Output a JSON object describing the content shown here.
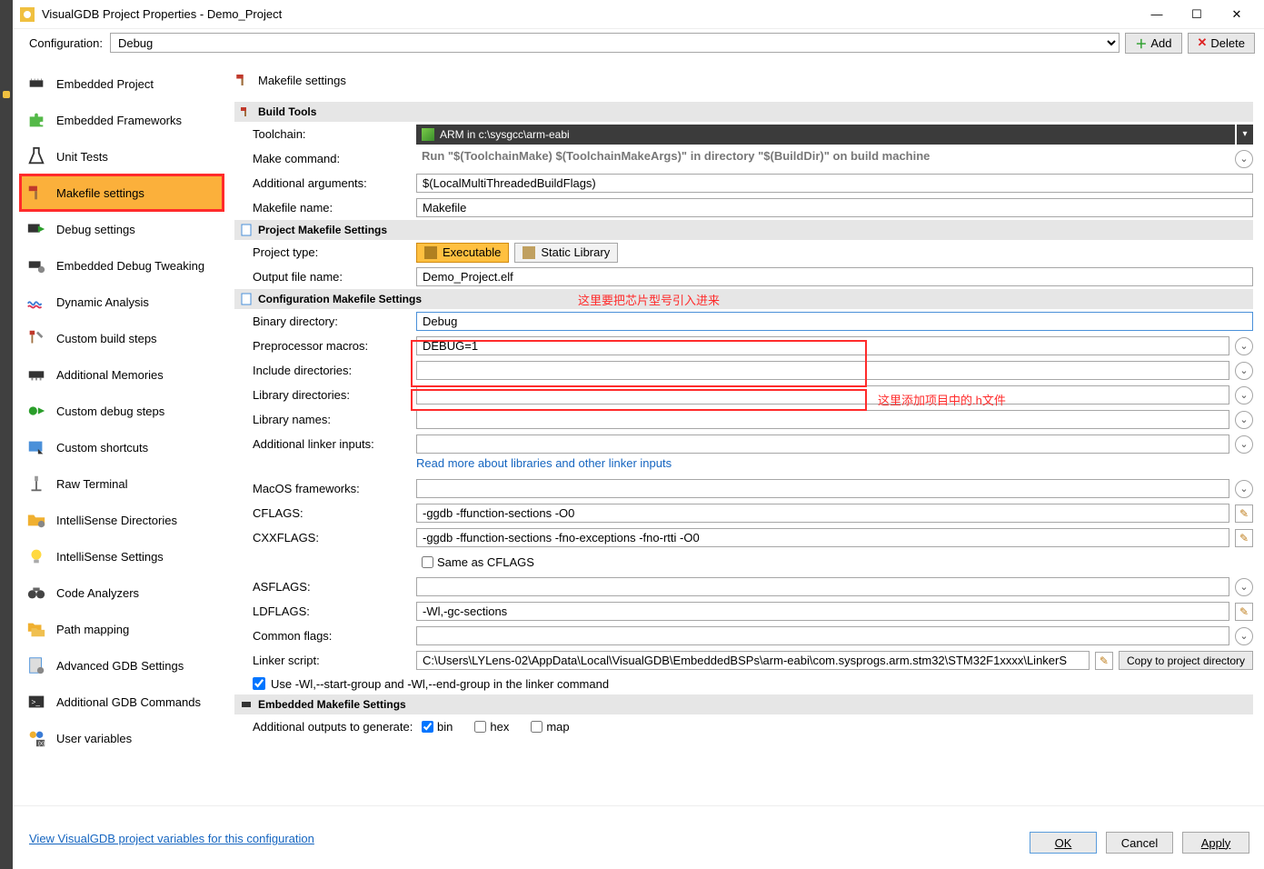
{
  "window": {
    "title": "VisualGDB Project Properties - Demo_Project"
  },
  "config": {
    "label": "Configuration:",
    "value": "Debug",
    "add": "Add",
    "delete": "Delete"
  },
  "sidebar": {
    "items": [
      {
        "label": "Embedded Project"
      },
      {
        "label": "Embedded Frameworks"
      },
      {
        "label": "Unit Tests"
      },
      {
        "label": "Makefile settings"
      },
      {
        "label": "Debug settings"
      },
      {
        "label": "Embedded Debug Tweaking"
      },
      {
        "label": "Dynamic Analysis"
      },
      {
        "label": "Custom build steps"
      },
      {
        "label": "Additional Memories"
      },
      {
        "label": "Custom debug steps"
      },
      {
        "label": "Custom shortcuts"
      },
      {
        "label": "Raw Terminal"
      },
      {
        "label": "IntelliSense Directories"
      },
      {
        "label": "IntelliSense Settings"
      },
      {
        "label": "Code Analyzers"
      },
      {
        "label": "Path mapping"
      },
      {
        "label": "Advanced GDB Settings"
      },
      {
        "label": "Additional GDB Commands"
      },
      {
        "label": "User variables"
      }
    ]
  },
  "content": {
    "title": "Makefile settings",
    "sections": {
      "build_tools": {
        "header": "Build Tools",
        "toolchain_label": "Toolchain:",
        "toolchain_value": "ARM in c:\\sysgcc\\arm-eabi",
        "make_cmd_label": "Make command:",
        "make_cmd_value": "Run \"$(ToolchainMake) $(ToolchainMakeArgs)\" in directory \"$(BuildDir)\" on build machine",
        "addl_args_label": "Additional arguments:",
        "addl_args_value": "$(LocalMultiThreadedBuildFlags)",
        "makefile_label": "Makefile name:",
        "makefile_value": "Makefile"
      },
      "project_mk": {
        "header": "Project Makefile Settings",
        "proj_type_label": "Project type:",
        "proj_type_exe": "Executable",
        "proj_type_lib": "Static Library",
        "out_name_label": "Output file name:",
        "out_name_value": "Demo_Project.elf"
      },
      "config_mk": {
        "header": "Configuration Makefile Settings",
        "annotation1": "这里要把芯片型号引入进来",
        "annotation2": "这里添加项目中的.h文件",
        "bin_dir_label": "Binary directory:",
        "bin_dir_value": "Debug",
        "preproc_label": "Preprocessor macros:",
        "preproc_value": "DEBUG=1",
        "include_label": "Include directories:",
        "include_value": "",
        "libdir_label": "Library directories:",
        "libdir_value": "",
        "libname_label": "Library names:",
        "libname_value": "",
        "linker_in_label": "Additional linker inputs:",
        "linker_in_value": "",
        "readmore": "Read more about libraries and other linker inputs",
        "macos_label": "MacOS frameworks:",
        "macos_value": "",
        "cflags_label": "CFLAGS:",
        "cflags_value": "-ggdb -ffunction-sections -O0",
        "cxxflags_label": "CXXFLAGS:",
        "cxxflags_value": "-ggdb -ffunction-sections -fno-exceptions -fno-rtti -O0",
        "same_as_cflags": "Same as CFLAGS",
        "asflags_label": "ASFLAGS:",
        "asflags_value": "",
        "ldflags_label": "LDFLAGS:",
        "ldflags_value": "-Wl,-gc-sections",
        "common_label": "Common flags:",
        "common_value": "",
        "linker_script_label": "Linker script:",
        "linker_script_value": "C:\\Users\\LYLens-02\\AppData\\Local\\VisualGDB\\EmbeddedBSPs\\arm-eabi\\com.sysprogs.arm.stm32\\STM32F1xxxx\\LinkerS",
        "copy_btn": "Copy to project directory",
        "use_wl_group": "Use -Wl,--start-group and -Wl,--end-group in the linker command"
      },
      "embedded_mk": {
        "header": "Embedded Makefile Settings",
        "addl_out_label": "Additional outputs to generate:",
        "bin": "bin",
        "hex": "hex",
        "map": "map"
      }
    }
  },
  "footer": {
    "link": "View VisualGDB project variables for this configuration",
    "ok": "OK",
    "cancel": "Cancel",
    "apply": "Apply"
  }
}
